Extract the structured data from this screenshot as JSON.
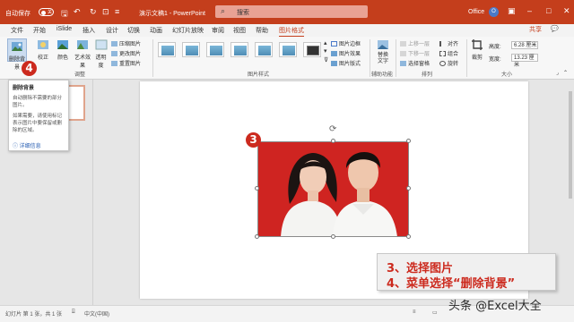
{
  "titlebar": {
    "autosave_label": "自动保存",
    "autosave_state": "关",
    "doc_title": "演示文稿1 - PowerPoint",
    "search_label": "搜索",
    "account_label": "Office",
    "avatar_letter": "O"
  },
  "tabs": [
    "文件",
    "开始",
    "iSlide",
    "插入",
    "设计",
    "切换",
    "动画",
    "幻灯片放映",
    "审阅",
    "视图",
    "帮助",
    "图片格式"
  ],
  "active_tab": "图片格式",
  "share_label": "共享",
  "comment_label": "",
  "ribbon": {
    "remove_bg_label": "删除背景",
    "correct_label": "校正",
    "color_label": "颜色",
    "art_effects_label": "艺术效果",
    "transparency_label": "透明度",
    "compress_label": "压缩图片",
    "change_label": "更改图片",
    "reset_label": "重置图片",
    "adjust_group": "调整",
    "styles_group": "图片样式",
    "border_label": "图片边框",
    "effects_label": "图片效果",
    "layout_label": "图片版式",
    "alt_text_label": "替换文字",
    "accessibility_group": "辅助功能",
    "bring_forward_label": "上移一层",
    "send_backward_label": "下移一层",
    "selection_pane_label": "选择窗格",
    "align_label": "对齐",
    "group_label": "组合",
    "rotate_label": "旋转",
    "arrange_group": "排列",
    "crop_label": "裁剪",
    "height_label": "高度:",
    "height_value": "6.28 厘米",
    "width_label": "宽度:",
    "width_value": "13.23 厘米",
    "size_group": "大小"
  },
  "tooltip": {
    "title": "删除背景",
    "p1": "自动删除不需要的部分图片。",
    "p2": "如果需要，请使用标记表示图片中要保留或删除的区域。",
    "link": "详细信息"
  },
  "badges": {
    "step3": "3",
    "step4": "4"
  },
  "caption": {
    "line1": "3、选择图片",
    "line2": "4、菜单选择“删除背景”"
  },
  "statusbar": {
    "slide_info": "幻灯片 第 1 张，共 1 张",
    "language": "中文(中国)"
  },
  "watermark": "头条 @Excel大全",
  "colors": {
    "accent": "#c43e1c",
    "badge": "#cc2a1e",
    "photo_bg": "#cf2421"
  }
}
